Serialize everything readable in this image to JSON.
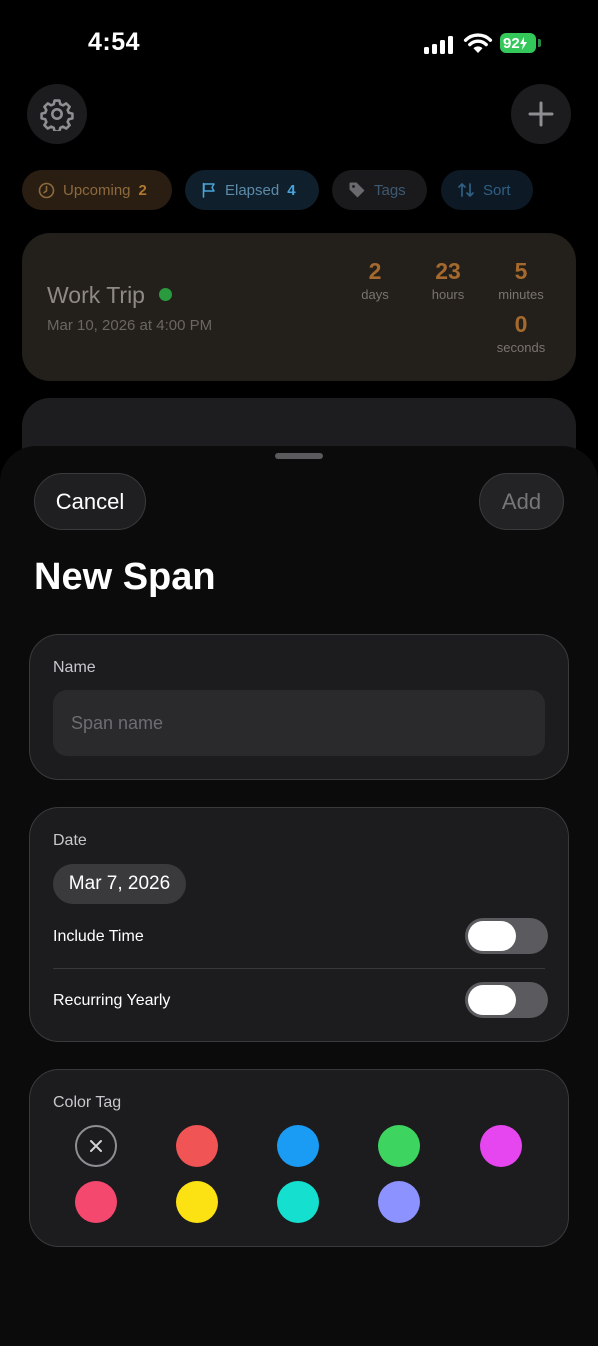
{
  "status": {
    "time": "4:54",
    "battery": "92"
  },
  "filters": {
    "upcoming": {
      "label": "Upcoming",
      "count": "2"
    },
    "elapsed": {
      "label": "Elapsed",
      "count": "4"
    },
    "tags": {
      "label": "Tags"
    },
    "sort": {
      "label": "Sort"
    }
  },
  "event_card": {
    "title": "Work Trip",
    "date": "Mar 10, 2026 at 4:00 PM",
    "countdown": [
      {
        "value": "2",
        "unit": "days"
      },
      {
        "value": "23",
        "unit": "hours"
      },
      {
        "value": "5",
        "unit": "minutes"
      },
      {
        "value": "0",
        "unit": "seconds"
      }
    ]
  },
  "sheet": {
    "cancel_label": "Cancel",
    "add_label": "Add",
    "title": "New Span",
    "name_section": {
      "label": "Name",
      "placeholder": "Span name",
      "value": ""
    },
    "date_section": {
      "label": "Date",
      "date_value": "Mar 7, 2026",
      "include_time": {
        "label": "Include Time",
        "on": false
      },
      "recurring_yearly": {
        "label": "Recurring Yearly",
        "on": false
      }
    },
    "color_section": {
      "label": "Color Tag",
      "swatches": [
        {
          "name": "none",
          "color": null
        },
        {
          "name": "red",
          "color": "#f05454"
        },
        {
          "name": "blue",
          "color": "#1a9bf4"
        },
        {
          "name": "green",
          "color": "#3dd45f"
        },
        {
          "name": "magenta",
          "color": "#e546ef"
        },
        {
          "name": "pink",
          "color": "#f4486f"
        },
        {
          "name": "yellow",
          "color": "#fde213"
        },
        {
          "name": "teal",
          "color": "#15e0cf"
        },
        {
          "name": "periwinkle",
          "color": "#8c92ff"
        }
      ]
    }
  },
  "colors": {
    "sheet_bg": "#0b0b0c",
    "section_bg": "#1c1c1e",
    "accent_orange": "#b0782f",
    "accent_blue": "#4aa3d8"
  }
}
